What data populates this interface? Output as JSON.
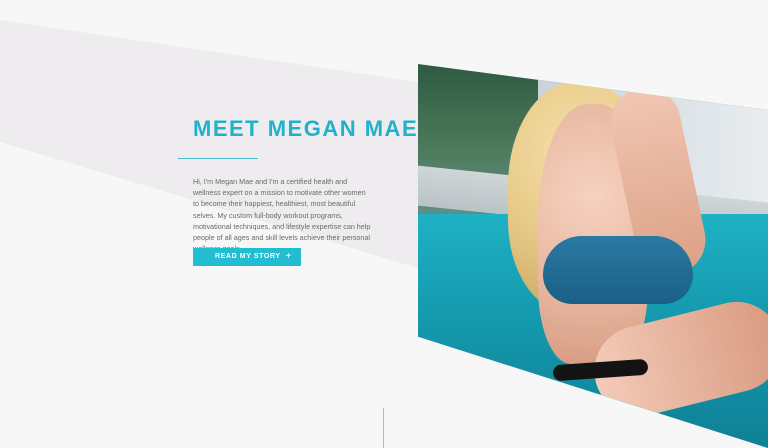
{
  "hero": {
    "title": "MEET MEGAN MAE",
    "bio": "Hi, I'm Megan Mae and I'm a certified health and wellness expert on a mission to motivate other women to become their happiest, healthiest, most beautiful selves. My custom full-body workout programs, motivational techniques, and lifestyle expertise can help people of all ages and skill levels achieve their personal wellness goals.",
    "button_label": "READ MY STORY",
    "button_icon": "plus-icon",
    "button_icon_glyph": "+"
  },
  "colors": {
    "accent": "#21b2c9",
    "button": "#22bdd1",
    "background": "#f7f7f8",
    "band": "#eeedef"
  }
}
